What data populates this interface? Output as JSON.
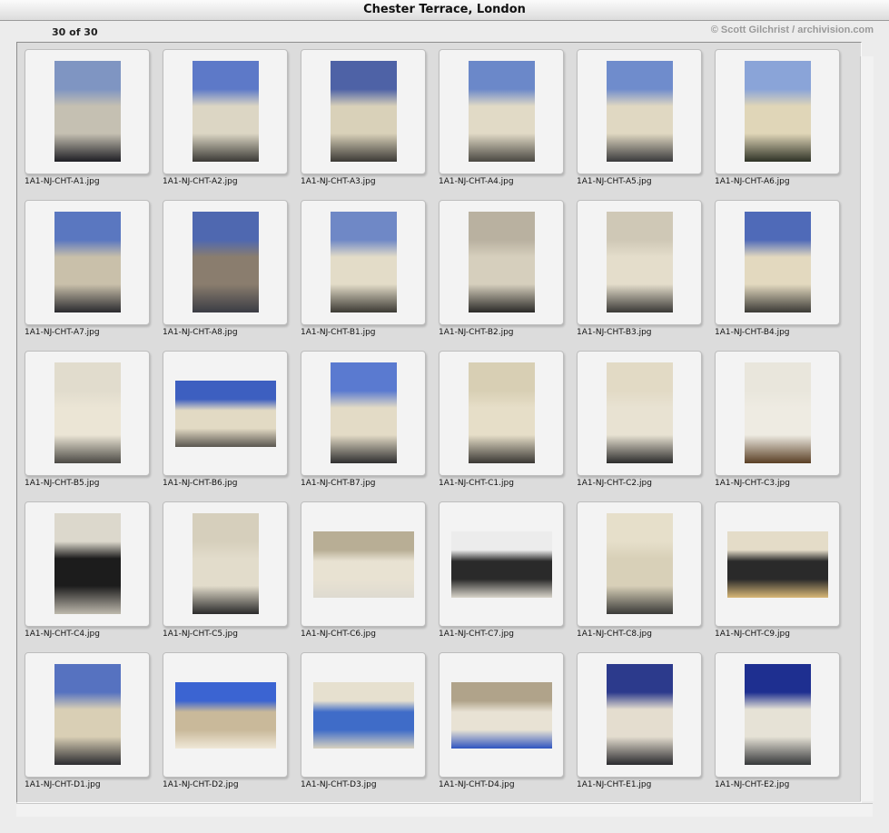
{
  "window": {
    "title": "Chester Terrace, London"
  },
  "info": {
    "count": "30 of 30",
    "credit": "© Scott Gilchrist / archivision.com"
  },
  "thumbnails": [
    {
      "filename": "1A1-NJ-CHT-A1.jpg",
      "orientation": "p",
      "colors": [
        "#7f95c2",
        "#c5c0b2",
        "#1e1e24"
      ]
    },
    {
      "filename": "1A1-NJ-CHT-A2.jpg",
      "orientation": "p",
      "colors": [
        "#5d79c8",
        "#dcd6c4",
        "#3b3a36"
      ]
    },
    {
      "filename": "1A1-NJ-CHT-A3.jpg",
      "orientation": "p",
      "colors": [
        "#4e62a6",
        "#d9d1b9",
        "#3c3a36"
      ]
    },
    {
      "filename": "1A1-NJ-CHT-A4.jpg",
      "orientation": "p",
      "colors": [
        "#6b88c9",
        "#e1dac6",
        "#4a4842"
      ]
    },
    {
      "filename": "1A1-NJ-CHT-A5.jpg",
      "orientation": "p",
      "colors": [
        "#6f8ccc",
        "#e0d8c2",
        "#3a3a3c"
      ]
    },
    {
      "filename": "1A1-NJ-CHT-A6.jpg",
      "orientation": "p",
      "colors": [
        "#8aa4d8",
        "#e0d6b8",
        "#2e3226"
      ]
    },
    {
      "filename": "1A1-NJ-CHT-A7.jpg",
      "orientation": "p",
      "colors": [
        "#5a77c0",
        "#c9c0aa",
        "#2a2a2e"
      ]
    },
    {
      "filename": "1A1-NJ-CHT-A8.jpg",
      "orientation": "p",
      "colors": [
        "#4f68b0",
        "#8a7d6e",
        "#3a3c44"
      ]
    },
    {
      "filename": "1A1-NJ-CHT-B1.jpg",
      "orientation": "p",
      "colors": [
        "#6f88c6",
        "#e3dcc8",
        "#3c3a34"
      ]
    },
    {
      "filename": "1A1-NJ-CHT-B2.jpg",
      "orientation": "p",
      "colors": [
        "#b9b1a0",
        "#d6cfbd",
        "#2b2a28"
      ]
    },
    {
      "filename": "1A1-NJ-CHT-B3.jpg",
      "orientation": "p",
      "colors": [
        "#cfc8b6",
        "#e4ddcb",
        "#3a3936"
      ]
    },
    {
      "filename": "1A1-NJ-CHT-B4.jpg",
      "orientation": "p",
      "colors": [
        "#4f6ab8",
        "#e3d9bf",
        "#3b3a36"
      ]
    },
    {
      "filename": "1A1-NJ-CHT-B5.jpg",
      "orientation": "p",
      "colors": [
        "#e1dccd",
        "#ebe5d5",
        "#4b4944"
      ]
    },
    {
      "filename": "1A1-NJ-CHT-B6.jpg",
      "orientation": "l",
      "colors": [
        "#3d5fc0",
        "#e2dac4",
        "#5a5650"
      ]
    },
    {
      "filename": "1A1-NJ-CHT-B7.jpg",
      "orientation": "p",
      "colors": [
        "#5a7ad0",
        "#e3dbc6",
        "#2f2f30"
      ]
    },
    {
      "filename": "1A1-NJ-CHT-C1.jpg",
      "orientation": "p",
      "colors": [
        "#d8cfb4",
        "#e6dec8",
        "#3a3834"
      ]
    },
    {
      "filename": "1A1-NJ-CHT-C2.jpg",
      "orientation": "p",
      "colors": [
        "#e2dac5",
        "#e8e2d2",
        "#2c2c2c"
      ]
    },
    {
      "filename": "1A1-NJ-CHT-C3.jpg",
      "orientation": "p",
      "colors": [
        "#e9e6dc",
        "#eeebe2",
        "#5a3f24"
      ]
    },
    {
      "filename": "1A1-NJ-CHT-C4.jpg",
      "orientation": "p",
      "colors": [
        "#dcd8cc",
        "#1c1c1c",
        "#bdb8ac"
      ]
    },
    {
      "filename": "1A1-NJ-CHT-C5.jpg",
      "orientation": "p",
      "colors": [
        "#d6cfbc",
        "#e2dccb",
        "#2a2a2a"
      ]
    },
    {
      "filename": "1A1-NJ-CHT-C6.jpg",
      "orientation": "l",
      "colors": [
        "#b8ae95",
        "#e8e2d2",
        "#dedad0"
      ]
    },
    {
      "filename": "1A1-NJ-CHT-C7.jpg",
      "orientation": "l",
      "colors": [
        "#ececec",
        "#2a2a2a",
        "#d8d4ca"
      ]
    },
    {
      "filename": "1A1-NJ-CHT-C8.jpg",
      "orientation": "p",
      "colors": [
        "#e6dfca",
        "#d8d0b8",
        "#3a3a38"
      ]
    },
    {
      "filename": "1A1-NJ-CHT-C9.jpg",
      "orientation": "l",
      "colors": [
        "#e4dcc8",
        "#2a2a2a",
        "#d8b878"
      ]
    },
    {
      "filename": "1A1-NJ-CHT-D1.jpg",
      "orientation": "p",
      "colors": [
        "#5672c0",
        "#d9cfb5",
        "#2c2c30"
      ]
    },
    {
      "filename": "1A1-NJ-CHT-D2.jpg",
      "orientation": "l",
      "colors": [
        "#3b64d2",
        "#c9b99a",
        "#efe8d8"
      ]
    },
    {
      "filename": "1A1-NJ-CHT-D3.jpg",
      "orientation": "l",
      "colors": [
        "#e6e0cf",
        "#3f6cc8",
        "#d9d2c0"
      ]
    },
    {
      "filename": "1A1-NJ-CHT-D4.jpg",
      "orientation": "l",
      "colors": [
        "#b0a38a",
        "#e8e2d4",
        "#2f54c0"
      ]
    },
    {
      "filename": "1A1-NJ-CHT-E1.jpg",
      "orientation": "p",
      "colors": [
        "#2c3a8c",
        "#e4ddcf",
        "#2a2a2e"
      ]
    },
    {
      "filename": "1A1-NJ-CHT-E2.jpg",
      "orientation": "p",
      "colors": [
        "#1e2f90",
        "#e6e2d6",
        "#36383a"
      ]
    }
  ]
}
